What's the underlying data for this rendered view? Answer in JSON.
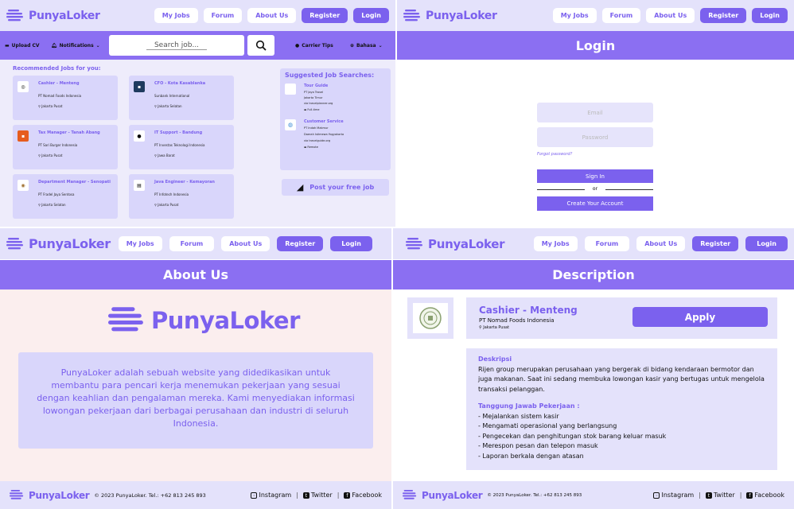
{
  "brand": {
    "name": "PunyaLoker",
    "color": "#7b61ee",
    "band_color": "#8b6ff2"
  },
  "nav": {
    "my_jobs": "My Jobs",
    "forum": "Forum",
    "about": "About Us",
    "register": "Register",
    "login": "Login"
  },
  "home": {
    "upload_cv": "Upload CV",
    "notifications": "Notifications",
    "search_placeholder": "Search job...",
    "carrier_tips": "Carrier Tips",
    "language": "Bahasa",
    "recommended_title": "Recommended Jobs for you:",
    "jobs": [
      {
        "title": "Cashier - Menteng",
        "company": "PT Nomad Foods Indonesia",
        "location": "Jakarta Pusat"
      },
      {
        "title": "CFO - Kota Kasablanka",
        "company": "Sunbank International",
        "location": "Jakarta Selatan"
      },
      {
        "title": "Tax Manager - Tanah Abang",
        "company": "PT Sari Burger Indonesia",
        "location": "Jakarta Pusat"
      },
      {
        "title": "IT Support - Bandung",
        "company": "PT Investas Teknologi Indonesia",
        "location": "Jawa Barat"
      },
      {
        "title": "Department Manager - Senopati",
        "company": "PT Fradel Jaya Sentosa",
        "location": "Jakarta Selatan"
      },
      {
        "title": "Java Engineer - Kemayoran",
        "company": "PT Infotech Indonesia",
        "location": "Jakarta Pusat"
      }
    ],
    "suggested_title": "Suggested Job Searches:",
    "suggested": [
      {
        "title": "Tour Guide",
        "company": "PT Jaya Travel",
        "region": "Jakarta Timur",
        "via": "via travelplanner.org",
        "type": "Full-time"
      },
      {
        "title": "Customer Service",
        "company": "PT Indah Makmur",
        "region": "Daerah Istimewa Yogyakarta",
        "via": "via travelguide.org",
        "type": "Remote"
      }
    ],
    "post_job": "Post your free job"
  },
  "login": {
    "title": "Login",
    "email_placeholder": "Email",
    "password_placeholder": "Password",
    "forgot": "Forgot password?",
    "sign_in": "Sign In",
    "or": "or",
    "create": "Create Your Account"
  },
  "about": {
    "title": "About Us",
    "text": "PunyaLoker adalah sebuah website yang didedikasikan untuk membantu para pencari kerja menemukan pekerjaan yang sesuai dengan keahlian dan pengalaman mereka. Kami menyediakan informasi lowongan pekerjaan dari berbagai perusahaan dan industri di seluruh Indonesia."
  },
  "desc": {
    "title": "Description",
    "job_title": "Cashier - Menteng",
    "company": "PT Nomad Foods Indonesia",
    "location": "Jakarta Pusat",
    "apply": "Apply",
    "desc_heading": "Deskripsi",
    "desc_text": "Rijen group merupakan perusahaan yang bergerak di bidang kendaraan bermotor dan juga makanan. Saat ini sedang membuka lowongan kasir yang bertugas untuk mengelola transaksi pelanggan.",
    "tasks_heading": "Tanggung Jawab Pekerjaan :",
    "tasks": [
      "- Mejalankan sistem kasir",
      "- Mengamati operasional yang berlangsung",
      "- Pengecekan dan penghitungan stok barang keluar masuk",
      "- Merespon pesan dan telepon masuk",
      "- Laporan berkala dengan atasan"
    ]
  },
  "footer": {
    "copyright": "© 2023 PunyaLoker. Tel.: +62 813 245 893",
    "instagram": "Instagram",
    "twitter": "Twitter",
    "facebook": "Facebook",
    "sep": "|"
  }
}
